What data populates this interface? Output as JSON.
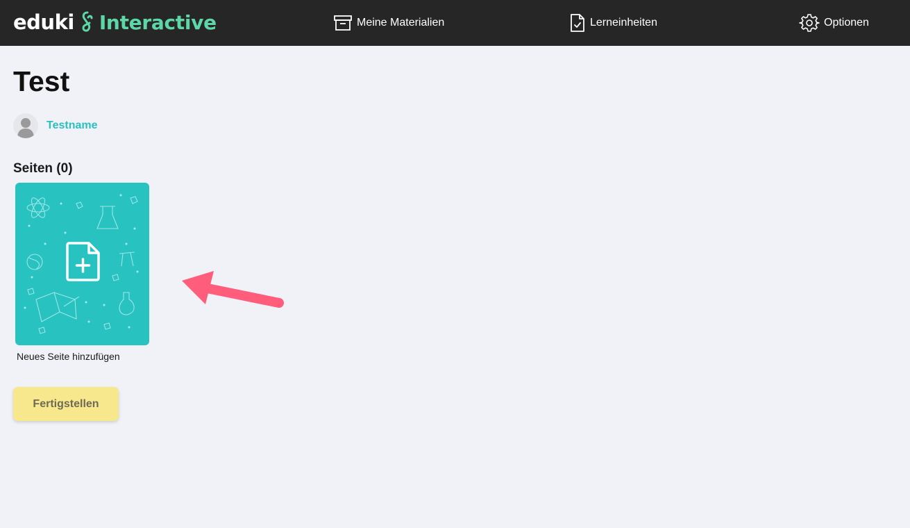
{
  "header": {
    "logo_primary": "eduki",
    "logo_secondary": "Interactive",
    "nav": [
      {
        "label": "Meine Materialien",
        "icon": "archive-box-icon"
      },
      {
        "label": "Lerneinheiten",
        "icon": "document-check-icon"
      },
      {
        "label": "Optionen",
        "icon": "gear-icon"
      }
    ]
  },
  "page": {
    "title": "Test",
    "author_name": "Testname",
    "pages_heading": "Seiten (0)",
    "add_page_label": "Neues Seite hinzufügen",
    "finish_label": "Fertigstellen"
  },
  "colors": {
    "header_bg": "#262626",
    "logo_accent": "#5dd6a8",
    "teal": "#28c2c1",
    "author_link": "#2bbfbd",
    "finish_button": "#f7e88e",
    "arrow": "#ff5d7b",
    "page_bg": "#f0f2f7"
  }
}
